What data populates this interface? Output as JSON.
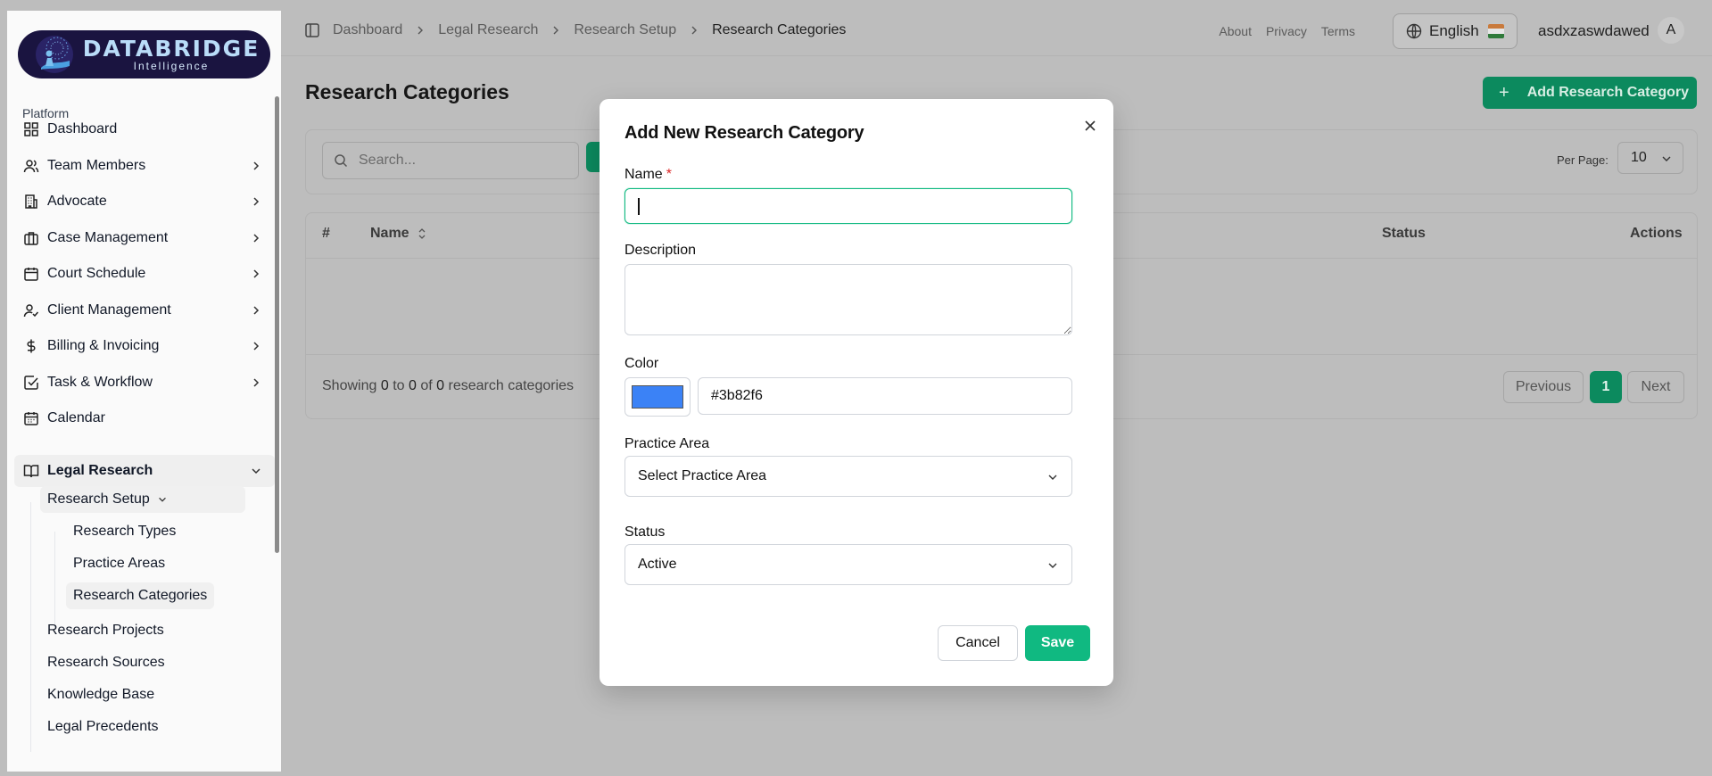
{
  "brand": {
    "name": "DATABRIDGE",
    "tagline": "Intelligence"
  },
  "sidebar": {
    "group_label": "Platform",
    "items": [
      {
        "label": "Dashboard",
        "icon": "grid-icon"
      },
      {
        "label": "Team Members",
        "icon": "users-icon"
      },
      {
        "label": "Advocate",
        "icon": "building-icon"
      },
      {
        "label": "Case Management",
        "icon": "briefcase-icon"
      },
      {
        "label": "Court Schedule",
        "icon": "calendar-icon"
      },
      {
        "label": "Client Management",
        "icon": "user-check-icon"
      },
      {
        "label": "Billing & Invoicing",
        "icon": "dollar-icon"
      },
      {
        "label": "Task & Workflow",
        "icon": "check-square-icon"
      },
      {
        "label": "Calendar",
        "icon": "calendar-icon"
      },
      {
        "label": "Legal Research",
        "icon": "book-open-icon"
      }
    ],
    "research_setup": "Research Setup",
    "setup_items": [
      "Research Types",
      "Practice Areas",
      "Research Categories"
    ],
    "research_items": [
      "Research Projects",
      "Research Sources",
      "Knowledge Base",
      "Legal Precedents"
    ]
  },
  "header": {
    "breadcrumbs": [
      "Dashboard",
      "Legal Research",
      "Research Setup",
      "Research Categories"
    ],
    "links": [
      "About",
      "Privacy",
      "Terms"
    ],
    "language": "English",
    "username": "asdxzaswdawed",
    "avatar_initial": "A"
  },
  "main": {
    "title": "Research Categories",
    "add_button": "Add Research Category",
    "search_placeholder": "Search...",
    "per_page_label": "Per Page:",
    "per_page_value": "10",
    "columns": {
      "index": "#",
      "name": "Name",
      "status": "Status",
      "actions": "Actions"
    },
    "showing": {
      "prefix": "Showing",
      "from": "0",
      "to_word": "to",
      "to": "0",
      "of_word": "of",
      "total": "0",
      "suffix": "research categories"
    },
    "pagination": {
      "previous": "Previous",
      "current": "1",
      "next": "Next"
    }
  },
  "modal": {
    "title": "Add New Research Category",
    "name_label": "Name",
    "required_mark": "*",
    "name_value": "",
    "description_label": "Description",
    "description_value": "",
    "color_label": "Color",
    "color_value": "#3b82f6",
    "practice_area_label": "Practice Area",
    "practice_area_value": "Select Practice Area",
    "status_label": "Status",
    "status_value": "Active",
    "cancel": "Cancel",
    "save": "Save"
  },
  "colors": {
    "accent": "#10b981",
    "accent_dimmed": "#0c8a5e",
    "overlay": "#bdbdbd",
    "swatch": "#3b82f6"
  }
}
